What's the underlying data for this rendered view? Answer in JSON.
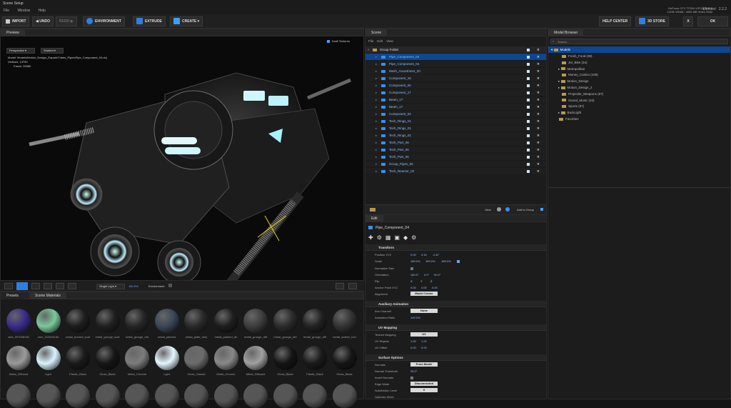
{
  "window": {
    "title": "Scene Setup",
    "menu": [
      "File",
      "Window",
      "Help"
    ],
    "gpu_line1": "GeForce GTX TITAN X/PCIe/SSE2",
    "gpu_line2": "12GB VRAM / 4096 MB Video RAM",
    "element_label": "Element",
    "element_version": "2.2.2"
  },
  "toolbar": {
    "import": "IMPORT",
    "undo": "UNDO",
    "redo": "REDO",
    "environment": "ENVIRONMENT",
    "extrude": "EXTRUDE",
    "create": "CREATE",
    "help_center": "HELP CENTER",
    "store": "3D STORE",
    "close": "X",
    "ok": "OK"
  },
  "preview": {
    "tab": "Preview",
    "draft_textures": "Draft Textures",
    "view_mode": "Perspective",
    "shade_mode": "Shaded",
    "model_label": "Model:",
    "model_path": "Models\\Motion_Design_2\\spark\\Tubes_Pipes\\Pipe_Component_04.obj",
    "vertices_label": "Vertices:",
    "vertices": "13790",
    "faces_label": "Faces:",
    "faces": "26960",
    "light_mode": "Single Light",
    "light_value": "100.0%",
    "environment_label": "Environment"
  },
  "materials": {
    "tabs": [
      "Presets",
      "Scene Materials"
    ],
    "row1": [
      {
        "name": "wire_057008156",
        "color": "#3a2c8c"
      },
      {
        "name": "wire_153228184",
        "color": "#79c99b"
      },
      {
        "name": "metal_burned_scat",
        "color": "#1d1d1d"
      },
      {
        "name": "metal_grunge_scat",
        "color": "#202020"
      },
      {
        "name": "metal_grunge_red",
        "color": "#262626"
      },
      {
        "name": "metal_painted",
        "color": "#3b4656"
      },
      {
        "name": "metal_plate_dirty",
        "color": "#2a2a2a"
      },
      {
        "name": "metal_painted_db",
        "color": "#1e1e1e"
      },
      {
        "name": "metal_grunge_diff",
        "color": "#3d3d3d"
      },
      {
        "name": "metal_grunge_dirt",
        "color": "#2c2c2c"
      },
      {
        "name": "metal_grunge_diff",
        "color": "#222222"
      },
      {
        "name": "metal_scatter_box",
        "color": "#333333"
      }
    ],
    "row2": [
      {
        "name": "Metal_Diffused",
        "color": "#9a9a9a"
      },
      {
        "name": "Light",
        "color": "#d8f4ff"
      },
      {
        "name": "Plastic_Black",
        "color": "#1a1a1a"
      },
      {
        "name": "Gloss_Black",
        "color": "#161616"
      },
      {
        "name": "Metal_Chrome",
        "color": "#7c7c7c"
      },
      {
        "name": "Light",
        "color": "#e4f7ff"
      },
      {
        "name": "Gloss_Classic",
        "color": "#6c6c6c"
      },
      {
        "name": "Metal_Chrome",
        "color": "#888888"
      },
      {
        "name": "Metal_Diffused",
        "color": "#a0a0a0"
      },
      {
        "name": "Gloss_Black",
        "color": "#141414"
      },
      {
        "name": "Plastic_Black",
        "color": "#1a1a1a"
      },
      {
        "name": "Gloss_Black",
        "color": "#161616"
      }
    ]
  },
  "scene": {
    "tab": "Scene",
    "menu": [
      "File",
      "Edit",
      "View"
    ],
    "root": "Group Folder",
    "items": [
      "Pipe_Component_04",
      "Pipe_Component_04",
      "Mesh_Assortment_20",
      "Component_16",
      "Component_06",
      "Component_17",
      "Beam_17",
      "Beam_17",
      "Component_02",
      "Tech_Rings_01",
      "Tech_Rings_01",
      "Tech_Rings_01",
      "Tech_Part_06",
      "Tech_Part_06",
      "Tech_Part_06",
      "Group_Pipes_06",
      "Tech_Reactor_02"
    ],
    "view_label": "View",
    "add_to_group": "Add to Group"
  },
  "edit": {
    "tab": "Edit",
    "object_name": "Pipe_Component_04",
    "transform": "Transform",
    "position_label": "Position XYZ",
    "position": [
      "0.00",
      "0.15",
      "-0.67"
    ],
    "scale_label": "Scale",
    "scale": [
      "189.0%",
      "189.0%",
      "189.0%"
    ],
    "normalize_label": "Normalize Size",
    "orientation_label": "Orientation",
    "orientation": [
      "180.0°",
      "0.0°",
      "90.0°"
    ],
    "flip_label": "Flip",
    "flip": [
      "X",
      "Y",
      "Z"
    ],
    "anchor_label": "Anchor Point XYZ",
    "anchor": [
      "0.00",
      "0.00",
      "0.00"
    ],
    "alignment_label": "Alignment",
    "alignment": "Model Center",
    "aux": "Auxiliary Animation",
    "aux_channel_label": "Aux Channel",
    "aux_channel": "None",
    "anim_ratio_label": "Animation Ratio",
    "anim_ratio": "100.0%",
    "uv": "UV Mapping",
    "tex_map_label": "Texture Mapping",
    "tex_map": "UV",
    "uv_repeat_label": "UV Repeat",
    "uv_repeat": [
      "1.00",
      "1.00"
    ],
    "uv_offset_label": "UV Offset",
    "uv_offset": [
      "0.00",
      "0.00"
    ],
    "surface": "Surface Options",
    "normals_label": "Normals",
    "normals": "From Model",
    "threshold_label": "Normal Threshold",
    "threshold": "35.0°",
    "invert_label": "Invert Normals",
    "edge_label": "Edge Mode",
    "edge": "Disconnected",
    "subdiv_label": "Subdivision Level",
    "subdiv": "0",
    "optimize_label": "Optimize Mesh"
  },
  "browser": {
    "tab": "Model Browser",
    "search_placeholder": "Search...",
    "root": "Models",
    "items": [
      "Fresh_Food (38)",
      "Jet_Bike (34)",
      "Metropolitan",
      "Money_Casino (108)",
      "Motion_Design",
      "Motion_Design_2",
      "Projectile_Weapons (87)",
      "Sound_Music (34)",
      "Sports (87)",
      "BackLight",
      "Favorites"
    ]
  },
  "colors": {
    "accent": "#2f7fe0",
    "selection": "#0e4690",
    "glow": "#a9f0ff"
  }
}
